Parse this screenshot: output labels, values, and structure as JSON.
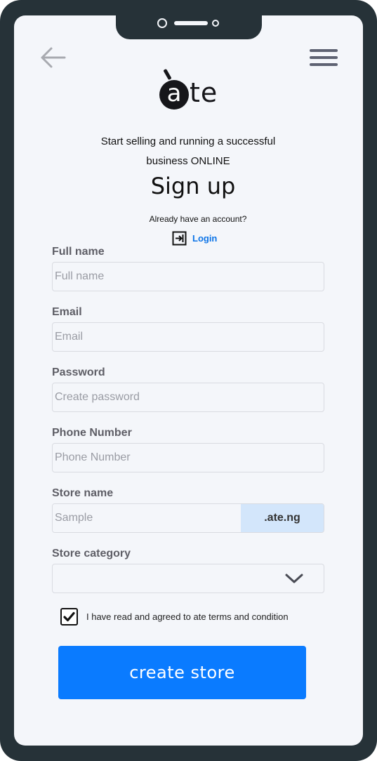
{
  "brand": {
    "logo_letter": "a",
    "logo_rest": "te"
  },
  "header": {
    "tagline_line1": "Start selling and running a successful",
    "tagline_line2": "business ONLINE",
    "title": "Sign up",
    "already_account": "Already have an account?",
    "login_label": "Login"
  },
  "form": {
    "full_name": {
      "label": "Full name",
      "placeholder": "Full name"
    },
    "email": {
      "label": "Email",
      "placeholder": "Email"
    },
    "password": {
      "label": "Password",
      "placeholder": "Create password"
    },
    "phone": {
      "label": "Phone Number",
      "placeholder": "Phone Number"
    },
    "store_name": {
      "label": "Store name",
      "placeholder": "Sample",
      "suffix": ".ate.ng"
    },
    "store_category": {
      "label": "Store category",
      "selected": ""
    },
    "terms": {
      "text": "I have read and agreed to ate terms and condition",
      "checked": true
    },
    "submit_label": "create store"
  },
  "icons": {
    "back": "arrow-left-icon",
    "menu": "hamburger-menu-icon",
    "login": "login-icon",
    "dropdown": "chevron-down-icon",
    "check": "checkmark-icon"
  },
  "colors": {
    "accent": "#0a7bff",
    "link": "#0d74e7",
    "frame": "#263238",
    "suffix_bg": "#d3e6fb"
  }
}
